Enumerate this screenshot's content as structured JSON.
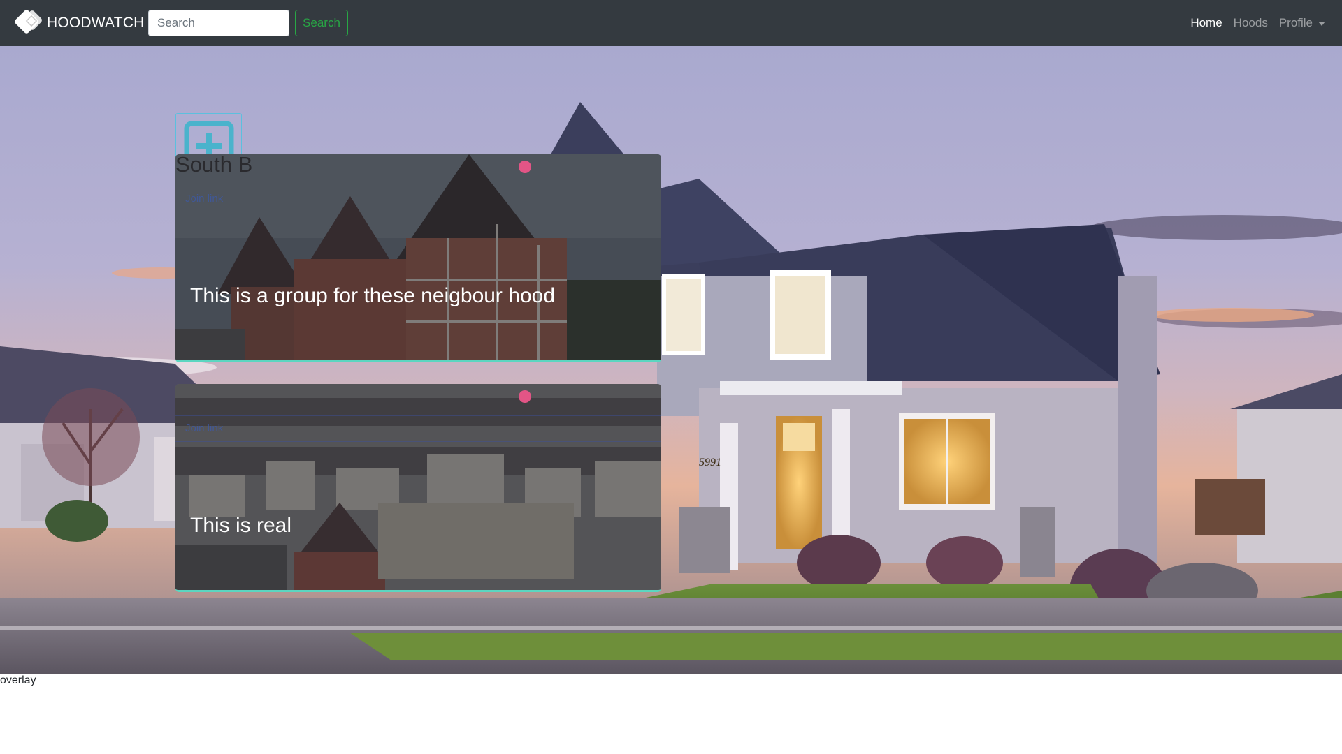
{
  "navbar": {
    "brand": "HOODWATCH",
    "search_placeholder": "Search",
    "search_button": "Search",
    "links": [
      {
        "label": "Home",
        "active": true
      },
      {
        "label": "Hoods",
        "active": false
      },
      {
        "label": "Profile",
        "active": false,
        "dropdown": true
      }
    ]
  },
  "hero": {
    "house_number": "5991",
    "add_button_icon": "plus-square-icon"
  },
  "hoods": [
    {
      "name": "South B",
      "link_label": "Join link",
      "description": "This is a group for these neigbour hood"
    },
    {
      "name": "",
      "link_label": "Join link",
      "description": "This is real"
    }
  ],
  "footer": {
    "text": "overlay"
  },
  "colors": {
    "navbar_bg": "#343a40",
    "search_button": "#28a745",
    "add_button": "#5bc0de",
    "card_accent": "#5bd6c0",
    "dot": "#e25586"
  }
}
